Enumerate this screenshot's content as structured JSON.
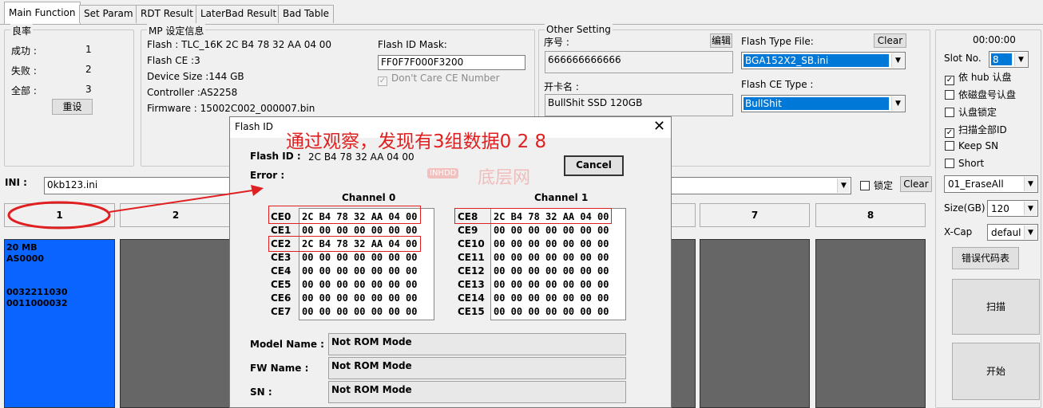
{
  "tabs": [
    "Main Function",
    "Set Param",
    "RDT Result",
    "LaterBad Result",
    "Bad Table"
  ],
  "stats": {
    "legend": "良率",
    "success_label": "成功 :",
    "success_value": "1",
    "fail_label": "失败 :",
    "fail_value": "2",
    "total_label": "全部 :",
    "total_value": "3",
    "reset_button": "重设"
  },
  "mp_info": {
    "legend": "MP 设定信息",
    "flash": "Flash : TLC_16K 2C B4 78 32 AA 04 00",
    "flash_ce": "Flash CE :3",
    "device_size": "Device Size :144 GB",
    "controller": "Controller :AS2258",
    "firmware": "Firmware : 15002C002_000007.bin",
    "flash_id_mask_label": "Flash ID Mask:",
    "flash_id_mask_value": "FF0F7F000F3200",
    "dont_care_label": "Don't Care CE Number"
  },
  "other_setting": {
    "legend": "Other Setting",
    "serial_label": "序号 :",
    "edit_button": "编辑",
    "serial_value": "666666666666",
    "open_name_label": "开卡名 :",
    "open_name_value": "BullShit SSD 120GB",
    "flash_type_file_label": "Flash Type File:",
    "clear_button": "Clear",
    "flash_type_file_value": "BGA152X2_SB.ini",
    "flash_ce_type_label": "Flash CE Type :",
    "flash_ce_type_value": "BullShit"
  },
  "right_panel": {
    "timer": "00:00:00",
    "slot_no_label": "Slot No.",
    "slot_no_value": "8",
    "hub_check": "依 hub 认盘",
    "disk_no_check": "依磁盘号认盘",
    "lock_check": "认盘锁定",
    "scan_all_check": "扫描全部ID",
    "keep_sn_check": "Keep SN",
    "short_check": "Short",
    "mode_value": "01_EraseAll",
    "size_label": "Size(GB)",
    "size_value": "120",
    "xcap_label": "X-Cap",
    "xcap_value": "default",
    "error_code_button": "错误代码表",
    "scan_button": "扫描",
    "start_button": "开始"
  },
  "ini": {
    "label": "INI :",
    "value": "0kb123.ini",
    "lock_label": "锁定",
    "clear_button": "Clear"
  },
  "slots": {
    "headers": [
      "1",
      "2",
      "7",
      "8"
    ],
    "slot1_lines": [
      "20 MB",
      "AS0000",
      "",
      "",
      "0032211030",
      "0011000032"
    ]
  },
  "annotation": {
    "text": "通过观察，发现有3组数据0 2 8",
    "watermark": "底层网",
    "watermark_badge": "INHDD"
  },
  "dialog": {
    "title": "Flash ID",
    "close_icon": "close-icon",
    "flash_id_label": "Flash ID :",
    "flash_id_value": "2C B4 78 32 AA 04 00",
    "error_label": "Error :",
    "cancel_button": "Cancel",
    "channel0_title": "Channel 0",
    "channel1_title": "Channel 1",
    "channel0": [
      {
        "ce": "CE0",
        "id": "2C B4 78 32 AA 04 00"
      },
      {
        "ce": "CE1",
        "id": "00 00 00 00 00 00 00"
      },
      {
        "ce": "CE2",
        "id": "2C B4 78 32 AA 04 00"
      },
      {
        "ce": "CE3",
        "id": "00 00 00 00 00 00 00"
      },
      {
        "ce": "CE4",
        "id": "00 00 00 00 00 00 00"
      },
      {
        "ce": "CE5",
        "id": "00 00 00 00 00 00 00"
      },
      {
        "ce": "CE6",
        "id": "00 00 00 00 00 00 00"
      },
      {
        "ce": "CE7",
        "id": "00 00 00 00 00 00 00"
      }
    ],
    "channel1": [
      {
        "ce": "CE8",
        "id": "2C B4 78 32 AA 04 00"
      },
      {
        "ce": "CE9",
        "id": "00 00 00 00 00 00 00"
      },
      {
        "ce": "CE10",
        "id": "00 00 00 00 00 00 00"
      },
      {
        "ce": "CE11",
        "id": "00 00 00 00 00 00 00"
      },
      {
        "ce": "CE12",
        "id": "00 00 00 00 00 00 00"
      },
      {
        "ce": "CE13",
        "id": "00 00 00 00 00 00 00"
      },
      {
        "ce": "CE14",
        "id": "00 00 00 00 00 00 00"
      },
      {
        "ce": "CE15",
        "id": "00 00 00 00 00 00 00"
      }
    ],
    "model_name_label": "Model Name :",
    "model_name_value": "Not ROM Mode",
    "fw_name_label": "FW Name :",
    "fw_name_value": "Not ROM Mode",
    "sn_label": "SN :",
    "sn_value": "Not ROM Mode"
  },
  "colors": {
    "slot_active": "#0a64ff",
    "slot_idle": "#666666",
    "annotation": "#e02020",
    "selection": "#0078d7"
  }
}
